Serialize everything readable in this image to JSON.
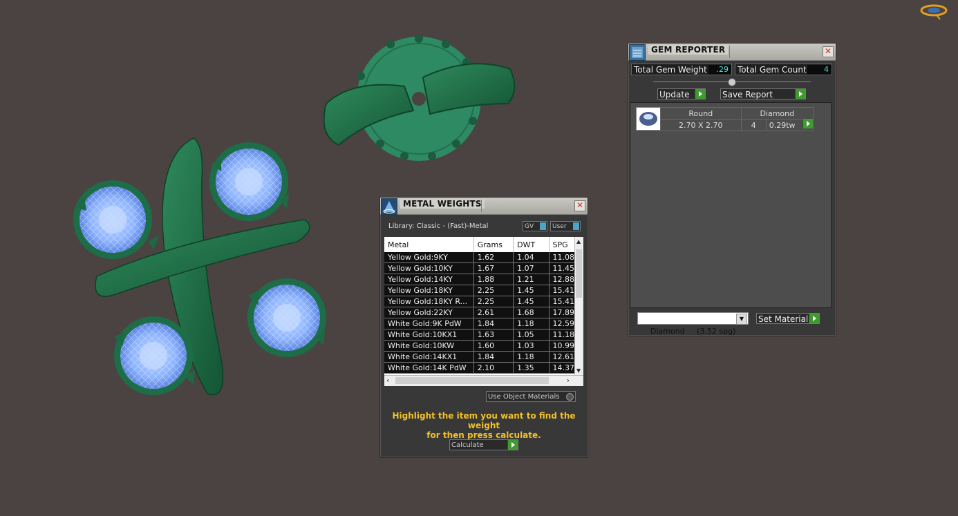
{
  "gem_reporter": {
    "title": "GEM REPORTER",
    "total_weight_label": "Total Gem Weight",
    "total_weight_value": ".29",
    "total_count_label": "Total Gem Count",
    "total_count_value": "4",
    "update_label": "Update",
    "save_report_label": "Save Report",
    "table": {
      "shape": "Round",
      "material": "Diamond",
      "size": "2.70 X 2.70",
      "count": "4",
      "weight": "0.29tw"
    },
    "material_select": "Diamond     (3.52 spg)",
    "set_material_label": "Set Material"
  },
  "metal_weights": {
    "title": "METAL WEIGHTS",
    "library_label": "Library: Classic - (Fast)-Metal",
    "gv_label": "GV",
    "user_label": "User",
    "columns": [
      "Metal",
      "Grams",
      "DWT",
      "SPG"
    ],
    "rows": [
      [
        "Yellow Gold:9KY",
        "1.62",
        "1.04",
        "11.08"
      ],
      [
        "Yellow Gold:10KY",
        "1.67",
        "1.07",
        "11.45"
      ],
      [
        "Yellow Gold:14KY",
        "1.88",
        "1.21",
        "12.88"
      ],
      [
        "Yellow Gold:18KY",
        "2.25",
        "1.45",
        "15.41"
      ],
      [
        "Yellow Gold:18KY R...",
        "2.25",
        "1.45",
        "15.41"
      ],
      [
        "Yellow Gold:22KY",
        "2.61",
        "1.68",
        "17.89"
      ],
      [
        "White Gold:9K PdW",
        "1.84",
        "1.18",
        "12.59"
      ],
      [
        "White Gold:10KX1",
        "1.63",
        "1.05",
        "11.18"
      ],
      [
        "White Gold:10KW",
        "1.60",
        "1.03",
        "10.99"
      ],
      [
        "White Gold:14KX1",
        "1.84",
        "1.18",
        "12.61"
      ],
      [
        "White Gold:14K PdW",
        "2.10",
        "1.35",
        "14.37"
      ]
    ],
    "use_object_materials_label": "Use Object Materials",
    "message_line1": "Highlight the item you want to find the weight",
    "message_line2": "for then press calculate.",
    "calculate_label": "Calculate"
  }
}
